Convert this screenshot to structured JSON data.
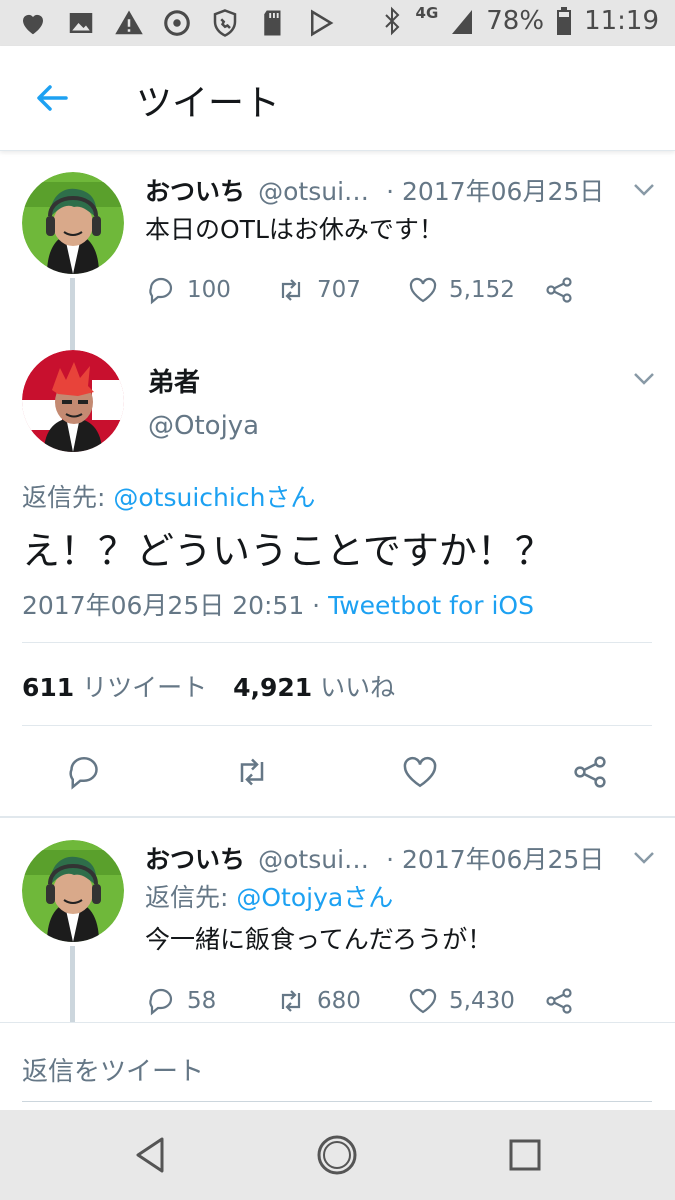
{
  "status_bar": {
    "icons_left": [
      "heart-icon",
      "image-icon",
      "warning-icon",
      "phone-settings-icon",
      "shield-phone-icon",
      "sd-card-icon",
      "play-store-icon"
    ],
    "network": "4G",
    "battery": "78%",
    "time": "11:19"
  },
  "app_bar": {
    "title": "ツイート"
  },
  "tweet1": {
    "name": "おついち",
    "handle": "@otsui…",
    "date": "· 2017年06月25日",
    "text": "本日のOTLはお休みです！",
    "replies": "100",
    "retweets": "707",
    "likes": "5,152"
  },
  "main_tweet": {
    "name": "弟者",
    "handle": "@Otojya",
    "reply_prefix": "返信先: ",
    "reply_mention": "@otsuichichさん",
    "text": "え！？どういうことですか！？",
    "timestamp": "2017年06月25日 20:51 · ",
    "client": "Tweetbot for iOS",
    "retweet_count": "611",
    "retweet_label": "リツイート",
    "like_count": "4,921",
    "like_label": "いいね"
  },
  "tweet3": {
    "name": "おついち",
    "handle": "@otsui…",
    "date": "· 2017年06月25日",
    "reply_prefix": "返信先: ",
    "reply_mention": "@Otojyaさん",
    "text": "今一緒に飯食ってんだろうが！",
    "replies": "58",
    "retweets": "680",
    "likes": "5,430"
  },
  "reply_box": {
    "placeholder": "返信をツイート"
  },
  "colors": {
    "accent": "#1da1f2",
    "secondary_text": "#657786",
    "primary_text": "#14171a"
  }
}
